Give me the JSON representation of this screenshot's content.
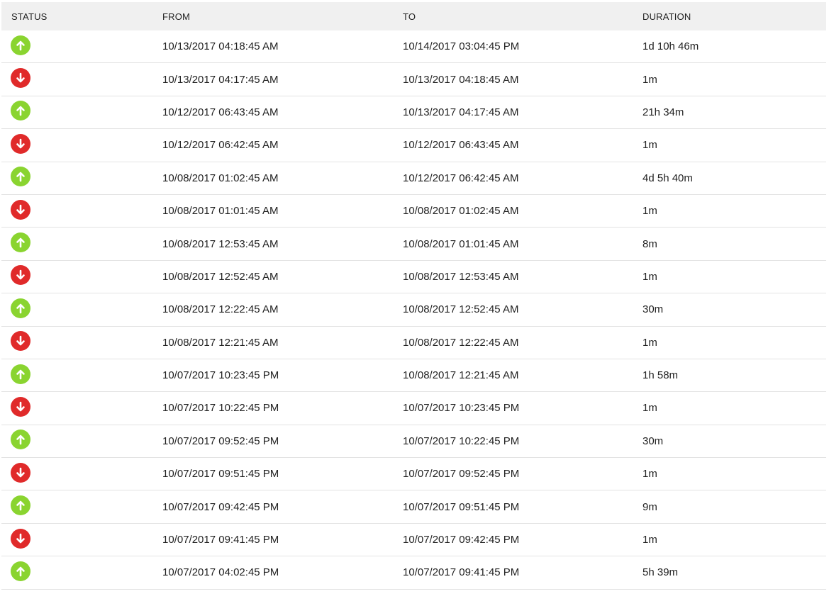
{
  "colors": {
    "up": "#8ad430",
    "down": "#e02a2a"
  },
  "columns": {
    "status": "STATUS",
    "from": "FROM",
    "to": "TO",
    "duration": "DURATION"
  },
  "rows": [
    {
      "status": "up",
      "icon": "arrow-up-icon",
      "from": "10/13/2017 04:18:45 AM",
      "to": "10/14/2017 03:04:45 PM",
      "duration": "1d 10h 46m"
    },
    {
      "status": "down",
      "icon": "arrow-down-icon",
      "from": "10/13/2017 04:17:45 AM",
      "to": "10/13/2017 04:18:45 AM",
      "duration": "1m"
    },
    {
      "status": "up",
      "icon": "arrow-up-icon",
      "from": "10/12/2017 06:43:45 AM",
      "to": "10/13/2017 04:17:45 AM",
      "duration": "21h 34m"
    },
    {
      "status": "down",
      "icon": "arrow-down-icon",
      "from": "10/12/2017 06:42:45 AM",
      "to": "10/12/2017 06:43:45 AM",
      "duration": "1m"
    },
    {
      "status": "up",
      "icon": "arrow-up-icon",
      "from": "10/08/2017 01:02:45 AM",
      "to": "10/12/2017 06:42:45 AM",
      "duration": "4d 5h 40m"
    },
    {
      "status": "down",
      "icon": "arrow-down-icon",
      "from": "10/08/2017 01:01:45 AM",
      "to": "10/08/2017 01:02:45 AM",
      "duration": "1m"
    },
    {
      "status": "up",
      "icon": "arrow-up-icon",
      "from": "10/08/2017 12:53:45 AM",
      "to": "10/08/2017 01:01:45 AM",
      "duration": "8m"
    },
    {
      "status": "down",
      "icon": "arrow-down-icon",
      "from": "10/08/2017 12:52:45 AM",
      "to": "10/08/2017 12:53:45 AM",
      "duration": "1m"
    },
    {
      "status": "up",
      "icon": "arrow-up-icon",
      "from": "10/08/2017 12:22:45 AM",
      "to": "10/08/2017 12:52:45 AM",
      "duration": "30m"
    },
    {
      "status": "down",
      "icon": "arrow-down-icon",
      "from": "10/08/2017 12:21:45 AM",
      "to": "10/08/2017 12:22:45 AM",
      "duration": "1m"
    },
    {
      "status": "up",
      "icon": "arrow-up-icon",
      "from": "10/07/2017 10:23:45 PM",
      "to": "10/08/2017 12:21:45 AM",
      "duration": "1h 58m"
    },
    {
      "status": "down",
      "icon": "arrow-down-icon",
      "from": "10/07/2017 10:22:45 PM",
      "to": "10/07/2017 10:23:45 PM",
      "duration": "1m"
    },
    {
      "status": "up",
      "icon": "arrow-up-icon",
      "from": "10/07/2017 09:52:45 PM",
      "to": "10/07/2017 10:22:45 PM",
      "duration": "30m"
    },
    {
      "status": "down",
      "icon": "arrow-down-icon",
      "from": "10/07/2017 09:51:45 PM",
      "to": "10/07/2017 09:52:45 PM",
      "duration": "1m"
    },
    {
      "status": "up",
      "icon": "arrow-up-icon",
      "from": "10/07/2017 09:42:45 PM",
      "to": "10/07/2017 09:51:45 PM",
      "duration": "9m"
    },
    {
      "status": "down",
      "icon": "arrow-down-icon",
      "from": "10/07/2017 09:41:45 PM",
      "to": "10/07/2017 09:42:45 PM",
      "duration": "1m"
    },
    {
      "status": "up",
      "icon": "arrow-up-icon",
      "from": "10/07/2017 04:02:45 PM",
      "to": "10/07/2017 09:41:45 PM",
      "duration": "5h 39m"
    }
  ]
}
